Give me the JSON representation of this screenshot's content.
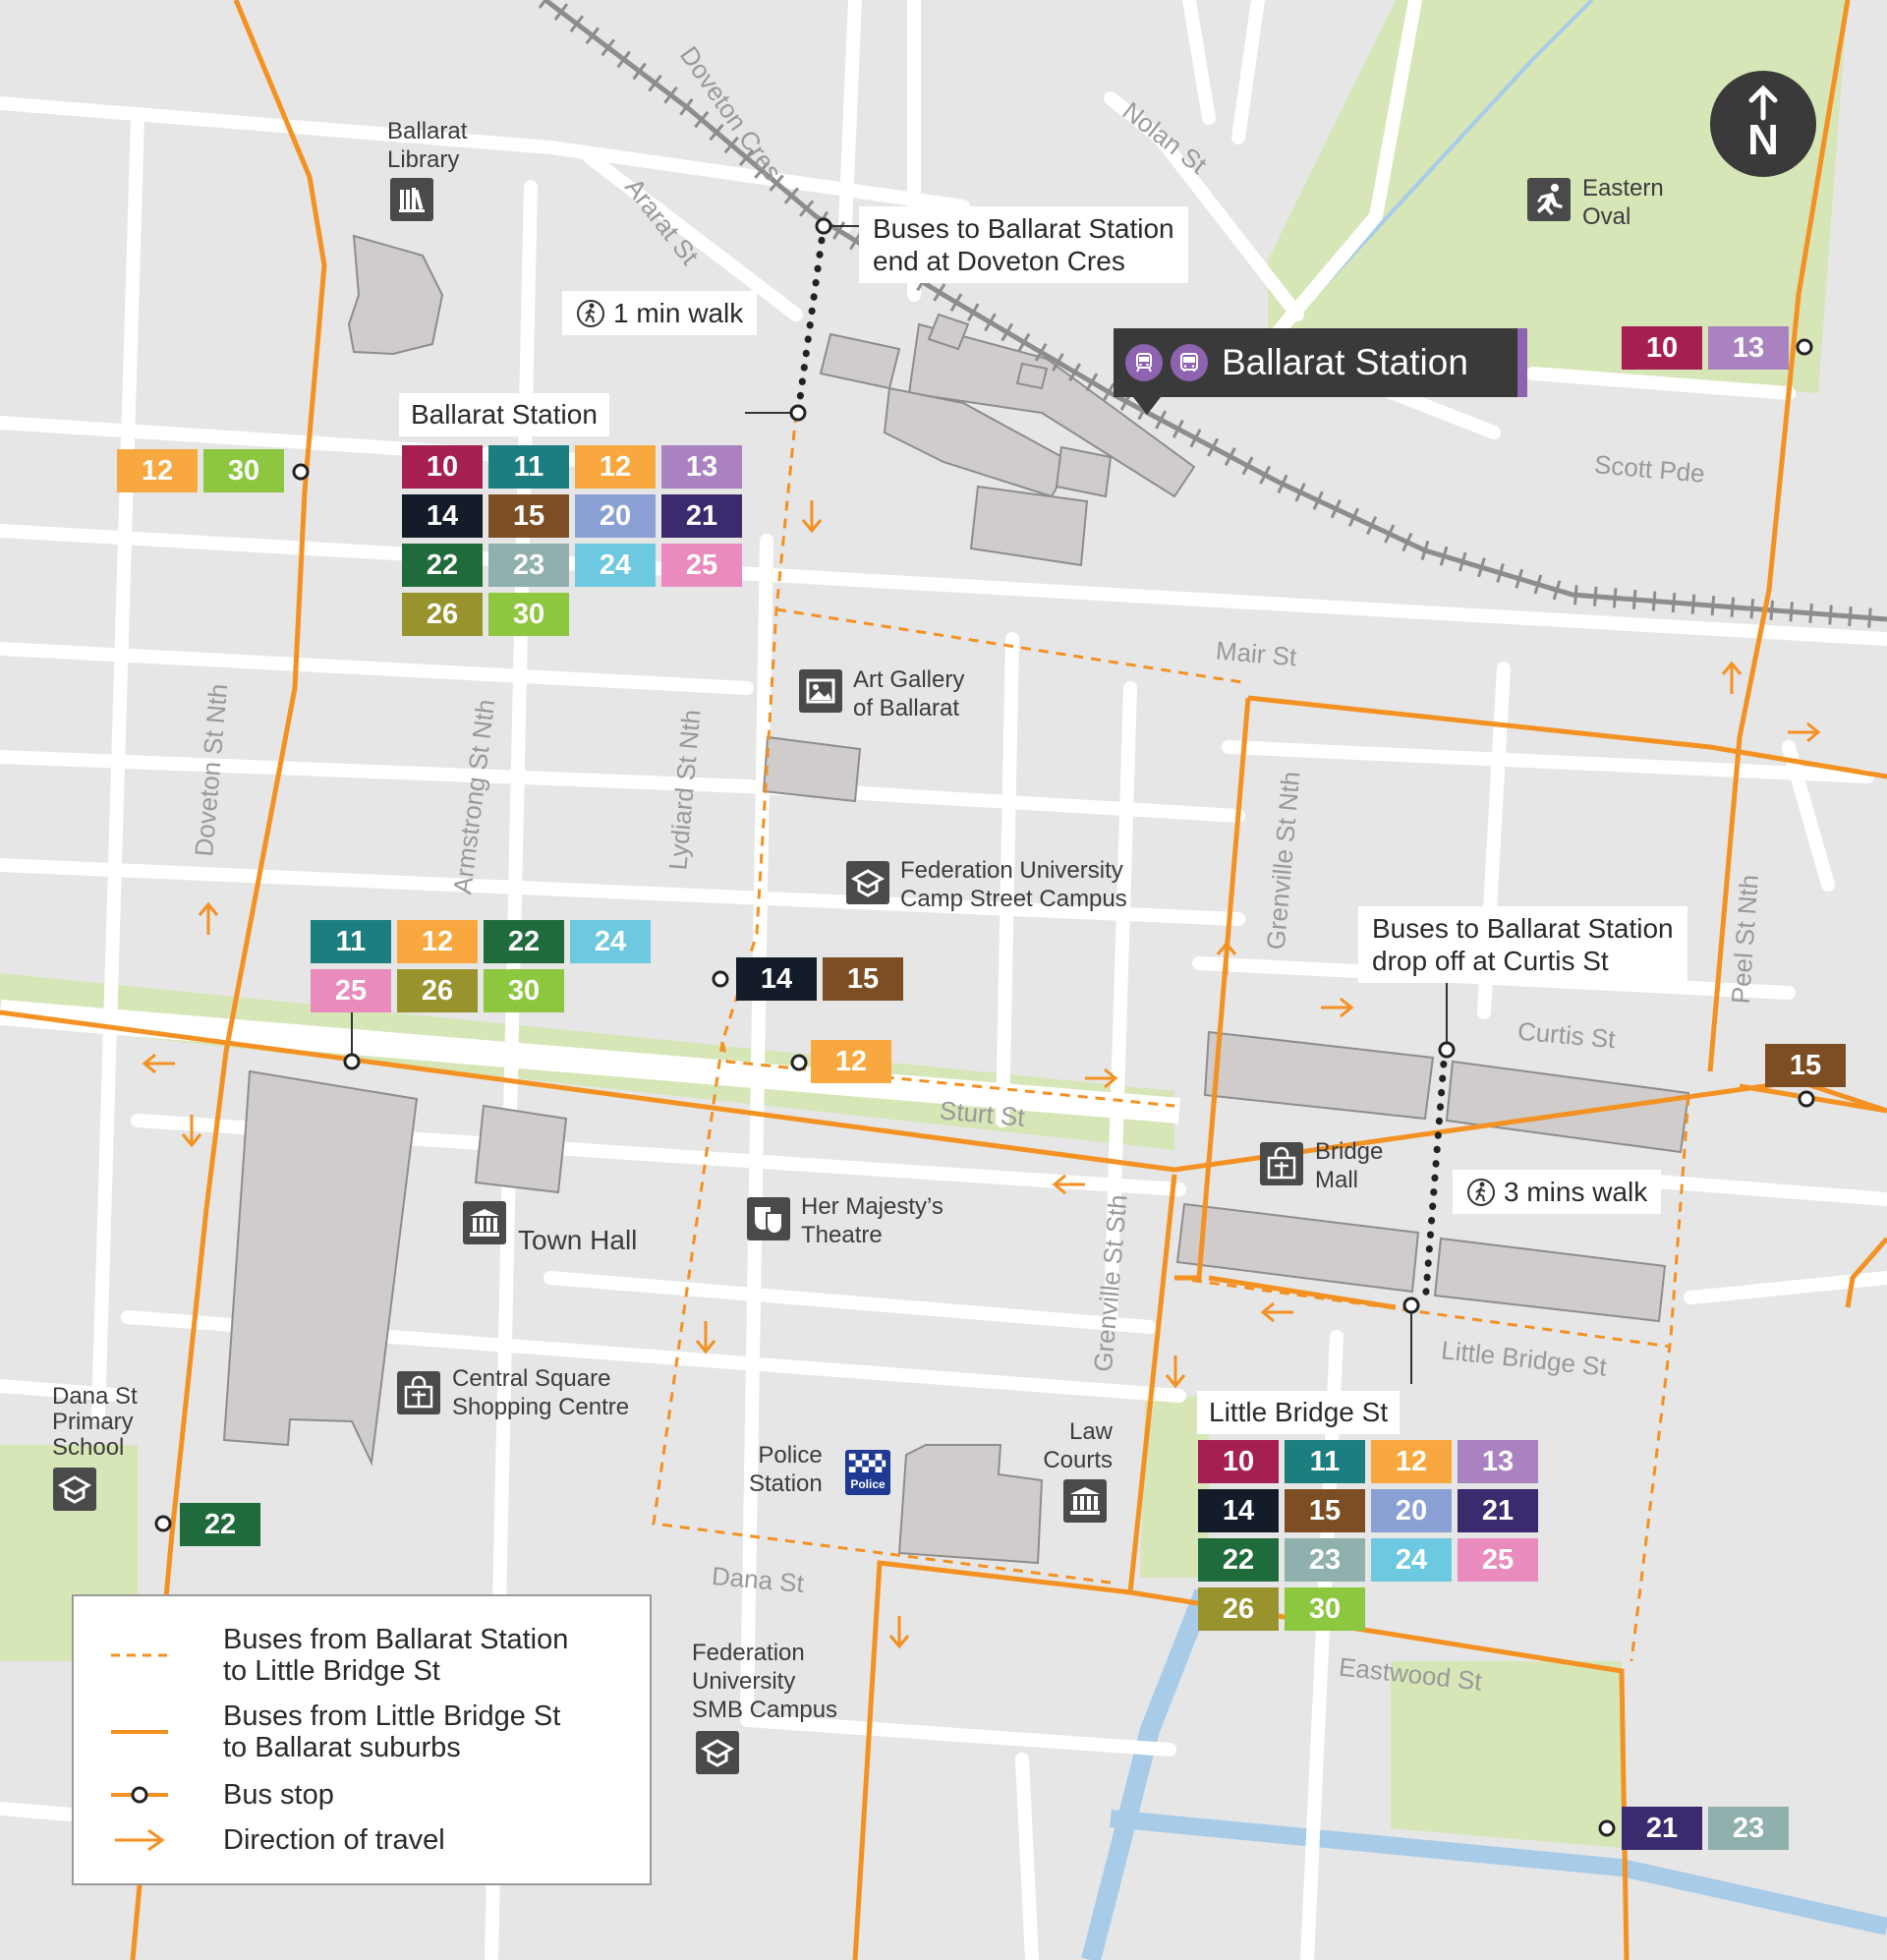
{
  "colors": {
    "orange": "#f39122",
    "purple_station": "#8e63b0",
    "park_green": "#d6e6b7",
    "water_blue": "#a8cbe8",
    "building_gray": "#cfcccb",
    "road_white": "#ffffff",
    "rail_gray": "#8d8d8d",
    "icon_dark": "#4a4a4a",
    "police_blue": "#1f3a93"
  },
  "route_colors": {
    "10": "#a51f53",
    "11": "#1c7e7e",
    "12": "#f8a83e",
    "13": "#aa82c0",
    "14": "#141c2a",
    "15": "#7d4e24",
    "20": "#8aa0d4",
    "21": "#3b2a6e",
    "22": "#1f6b3b",
    "23": "#8fb0ac",
    "24": "#6cc9df",
    "25": "#ea8bbd",
    "26": "#99932d",
    "30": "#8dc63f"
  },
  "streets": {
    "doveton_cres": "Doveton Cres",
    "nolan_st": "Nolan St",
    "ararat_st": "Ararat St",
    "scott_pde": "Scott Pde",
    "mair_st": "Mair St",
    "doveton_st_nth": "Doveton St Nth",
    "armstrong_st_nth": "Armstrong St Nth",
    "lydiard_st_nth": "Lydiard St Nth",
    "grenville_st_nth": "Grenville St Nth",
    "peel_st_nth": "Peel St Nth",
    "curtis_st": "Curtis St",
    "sturt_st": "Sturt St",
    "grenville_st_sth": "Grenville St Sth",
    "little_bridge_st": "Little Bridge St",
    "dana_st": "Dana St",
    "eastwood_st": "Eastwood St"
  },
  "places": {
    "library": [
      "Ballarat",
      "Library"
    ],
    "eastern_oval": [
      "Eastern",
      "Oval"
    ],
    "art_gallery": [
      "Art Gallery",
      "of Ballarat"
    ],
    "fed_uni_camp": [
      "Federation University",
      "Camp Street Campus"
    ],
    "town_hall": "Town Hall",
    "her_majestys": [
      "Her Majesty’s",
      "Theatre"
    ],
    "bridge_mall": [
      "Bridge",
      "Mall"
    ],
    "central_square": [
      "Central Square",
      "Shopping Centre"
    ],
    "dana_st_school": [
      "Dana St",
      "Primary",
      "School"
    ],
    "police": [
      "Police",
      "Station"
    ],
    "police_badge": "Police",
    "law_courts": [
      "Law",
      "Courts"
    ],
    "fed_uni_smb": [
      "Federation",
      "University",
      "SMB Campus"
    ]
  },
  "station_banner": {
    "name": "Ballarat Station",
    "icons": [
      "train-icon",
      "bus-icon"
    ]
  },
  "north": "N",
  "callouts": {
    "doveton_end": [
      "Buses to Ballarat Station",
      "end at Doveton Cres"
    ],
    "curtis_dropoff": [
      "Buses to Ballarat Station",
      "drop off at Curtis St"
    ],
    "walk_1": "1 min walk",
    "walk_3": "3 mins walk"
  },
  "stop_labels": {
    "ballarat_station": "Ballarat Station",
    "little_bridge_st": "Little Bridge St"
  },
  "stops": {
    "ballarat_station": [
      "10",
      "11",
      "12",
      "13",
      "14",
      "15",
      "20",
      "21",
      "22",
      "23",
      "24",
      "25",
      "26",
      "30"
    ],
    "little_bridge_st": [
      "10",
      "11",
      "12",
      "13",
      "14",
      "15",
      "20",
      "21",
      "22",
      "23",
      "24",
      "25",
      "26",
      "30"
    ],
    "doveton_north": [
      "12",
      "30"
    ],
    "eastern_oval": [
      "10",
      "13"
    ],
    "sturt_st": [
      "11",
      "12",
      "22",
      "24",
      "25",
      "26",
      "30"
    ],
    "lydiard": [
      "14",
      "15"
    ],
    "lydiard_sturt": [
      "12"
    ],
    "curtis_east": [
      "15"
    ],
    "doveton_south": [
      "22"
    ],
    "eastwood": [
      "21",
      "23"
    ]
  },
  "legend": {
    "dashed": [
      "Buses from Ballarat Station",
      "to Little Bridge St"
    ],
    "solid": [
      "Buses from Little Bridge St",
      "to Ballarat suburbs"
    ],
    "stop": "Bus stop",
    "direction": "Direction of travel"
  }
}
